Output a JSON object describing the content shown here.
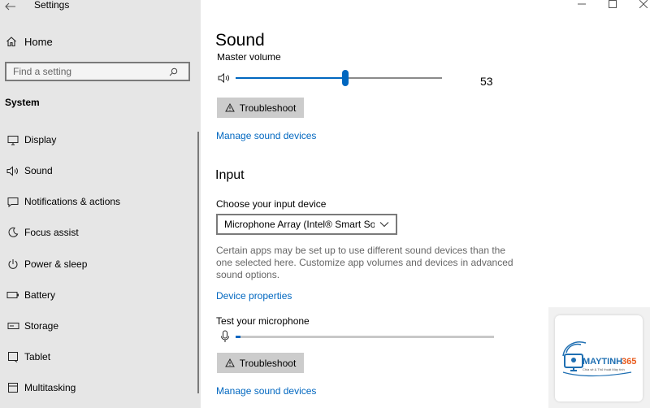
{
  "window": {
    "title": "Settings",
    "controls": [
      "minimize",
      "maximize",
      "close"
    ]
  },
  "sidebar": {
    "home_label": "Home",
    "search_placeholder": "Find a setting",
    "section_title": "System",
    "items": [
      {
        "label": "Display",
        "icon": "monitor-icon"
      },
      {
        "label": "Sound",
        "icon": "speaker-icon"
      },
      {
        "label": "Notifications & actions",
        "icon": "notification-icon"
      },
      {
        "label": "Focus assist",
        "icon": "moon-icon"
      },
      {
        "label": "Power & sleep",
        "icon": "power-icon"
      },
      {
        "label": "Battery",
        "icon": "battery-icon"
      },
      {
        "label": "Storage",
        "icon": "storage-icon"
      },
      {
        "label": "Tablet",
        "icon": "tablet-icon"
      },
      {
        "label": "Multitasking",
        "icon": "multitasking-icon"
      }
    ]
  },
  "main": {
    "title": "Sound",
    "output": {
      "master_volume_label": "Master volume",
      "volume_value": "53",
      "volume_level": 0.53,
      "troubleshoot_label": "Troubleshoot",
      "manage_devices_link": "Manage sound devices"
    },
    "input": {
      "heading": "Input",
      "choose_device_label": "Choose your input device",
      "selected_device": "Microphone Array (Intel® Smart So...",
      "help_text": "Certain apps may be set up to use different sound devices than the one selected here. Customize app volumes and devices in advanced sound options.",
      "device_properties_link": "Device properties",
      "test_mic_label": "Test your microphone",
      "mic_level": 0.02,
      "troubleshoot_label": "Troubleshoot",
      "manage_devices_link": "Manage sound devices"
    }
  },
  "watermark": {
    "brand": "MAYTINH365",
    "tagline": "Chia sẻ & Thủ thuật Máy tính"
  },
  "colors": {
    "accent": "#0067c0",
    "sidebar_bg": "#e6e6e6",
    "button_bg": "#cccccc",
    "brand_blue": "#1f6fb2"
  }
}
